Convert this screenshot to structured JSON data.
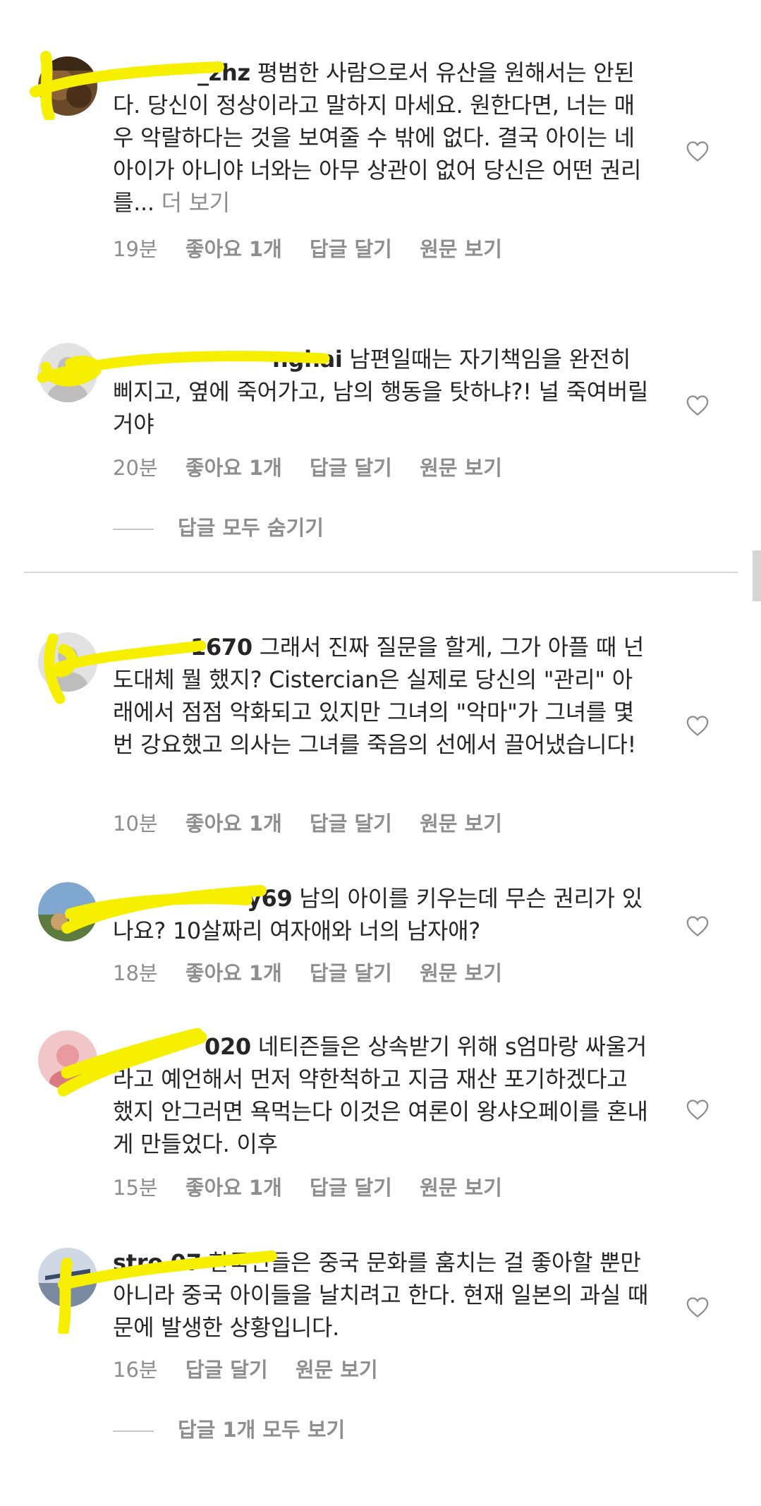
{
  "colors": {
    "text": "#262626",
    "secondary": "#8e8e8e",
    "highlight": "#f6ef00",
    "divider": "#dbdbdb"
  },
  "comments": [
    {
      "username_visible": "_zhz",
      "text": "평범한 사람으로서 유산을 원해서는 안된다. 당신이 정상이라고 말하지 마세요. 원한다면, 너는 매우 악랄하다는 것을 보여줄 수 밖에 없다. 결국 아이는 네 아이가 아니야 너와는 아무 상관이 없어 당신은 어떤 권리를...",
      "more": "더 보기",
      "time": "19분",
      "likes": "좋아요 1개",
      "reply": "답글 달기",
      "original": "원문 보기"
    },
    {
      "username_visible": "nghai",
      "text": "남편일때는 자기책임을 완전히 삐지고, 옆에 죽어가고, 남의 행동을 탓하냐?! 널 죽여버릴거야",
      "time": "20분",
      "likes": "좋아요 1개",
      "reply": "답글 달기",
      "original": "원문 보기"
    },
    {
      "username_visible": "1670",
      "text": "그래서 진짜 질문을 할게, 그가 아플 때 넌 도대체 뭘 했지? Cistercian은 실제로 당신의 \"관리\" 아래에서 점점 악화되고 있지만 그녀의 \"악마\"가 그녀를 몇 번 강요했고 의사는 그녀를 죽음의 선에서 끌어냈습니다!",
      "time": "10분",
      "likes": "좋아요 1개",
      "reply": "답글 달기",
      "original": "원문 보기"
    },
    {
      "username_visible": "y69",
      "text": "남의 아이를 키우는데 무슨 권리가 있나요? 10살짜리 여자애와 너의 남자애?",
      "time": "18분",
      "likes": "좋아요 1개",
      "reply": "답글 달기",
      "original": "원문 보기"
    },
    {
      "username_visible": "020",
      "text": "네티즌들은 상속받기 위해 s엄마랑 싸울거라고 예언해서 먼저 약한척하고 지금 재산 포기하겠다고 했지 안그러면 욕먹는다 이것은 여론이 왕샤오페이를 혼내게 만들었다. 이후",
      "time": "15분",
      "likes": "좋아요 1개",
      "reply": "답글 달기",
      "original": "원문 보기"
    },
    {
      "username_visible": "stro 07",
      "text": "한국인들은 중국 문화를 훔치는 걸 좋아할 뿐만 아니라 중국 아이들을 날치려고 한다. 현재 일본의 과실 때문에 발생한 상황입니다.",
      "time": "16분",
      "reply": "답글 달기",
      "original": "원문 보기"
    }
  ],
  "hide_replies": "답글 모두 숨기기",
  "view_replies": "답글 1개 모두 보기"
}
